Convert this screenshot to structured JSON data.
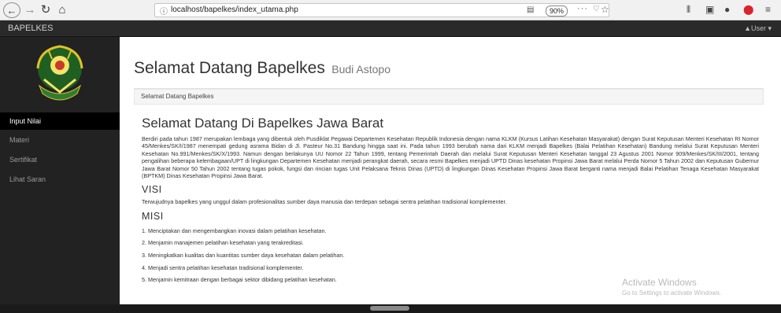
{
  "browser": {
    "url": "localhost/bapelkes/index_utama.php",
    "zoom": "90%",
    "back_icon": "arrow-left",
    "forward_icon": "arrow-right",
    "reload_icon": "reload",
    "home_icon": "home"
  },
  "navbar": {
    "brand": "BAPELKES",
    "user_menu": "▲User ▾"
  },
  "sidebar": {
    "items": [
      {
        "label": "Input Nilai",
        "active": true
      },
      {
        "label": "Materi",
        "active": false
      },
      {
        "label": "Sertifikat",
        "active": false
      },
      {
        "label": "Lihat Saran",
        "active": false
      }
    ]
  },
  "page": {
    "title": "Selamat Datang Bapelkes",
    "subtitle": "Budi Astopo",
    "breadcrumb": "Selamat Datang Bapelkes"
  },
  "content": {
    "heading": "Selamat Datang Di Bapelkes Jawa Barat",
    "intro": "Berdiri pada tahun 1987 merupakan lembaga yang dibentuk oleh Pusdiklat Pegawai Departemen Kesehatan Republik Indonesia dengan nama KLKM (Kursus Latihan Kesehatan Masyarakat) dengan Surat Keputusan Menteri Kesehatan RI Nomor 45/Menkes/SK/I/1987 menempati gedung asrama Bidan di Jl. Pasteur No.31 Bandung hingga saat ini. Pada tahun 1993 berubah nama dari KLKM menjadi Bapelkes (Balai Pelatihan Kesehatan) Bandung melalui Surat Keputusan Menteri Kesehatan No.991/Menkes/SK/X/1993. Namun dengan berlakunya UU Nomor 22 Tahun 1999, tentang Pemerintah Daerah dan melalui Surat Keputusan Menteri Kesehatan tanggal 23 Agustus 2001 Nomor 909/Menkes/SK/III/2001, tentang pengalihan beberapa kelembagaan/UPT di lingkungan Departemen Kesehatan menjadi perangkat daerah, secara resmi Bapelkes menjadi UPTD Dinas kesehatan Propinsi Jawa Barat melalui Perda Nomor 5 Tahun 2002 dan Keputusan Gubernur Jawa Barat Nomor 50 Tahun 2002 tentang tugas pokok, fungsi dan rincian tugas Unit Pelaksana Teknis Dinas (UPTD) di lingkungan Dinas Kesehatan Propinsi Jawa Barat berganti nama menjadi Balai Pelatihan Tenaga Kesehatan Masyarakat (BPTKM) Dinas Kesehatan Propinsi Jawa Barat.",
    "visi_title": "VISI",
    "visi_text": "Terwujudnya bapelkes yang unggul dalam profesionalitas sumber daya manusia dan terdepan sebagai sentra pelatihan tradisional komplementer.",
    "misi_title": "MISI",
    "misi_items": [
      "1. Menciptakan dan mengembangkan inovasi dalam pelatihan kesehatan.",
      "2. Menjamin manajemen pelatihan kesehatan yang terakreditasi.",
      "3. Meningkatkan kualitas dan kuantitas sumber daya kesehatan dalam pelatihan.",
      "4. Menjadi sentra pelatihan kesehatan tradisional komplementer.",
      "5. Menjamin kemitraan dengan berbagai sektor dibidang pelatihan kesehatan."
    ]
  },
  "watermark": {
    "title": "Activate Windows",
    "subtitle": "Go to Settings to activate Windows."
  }
}
